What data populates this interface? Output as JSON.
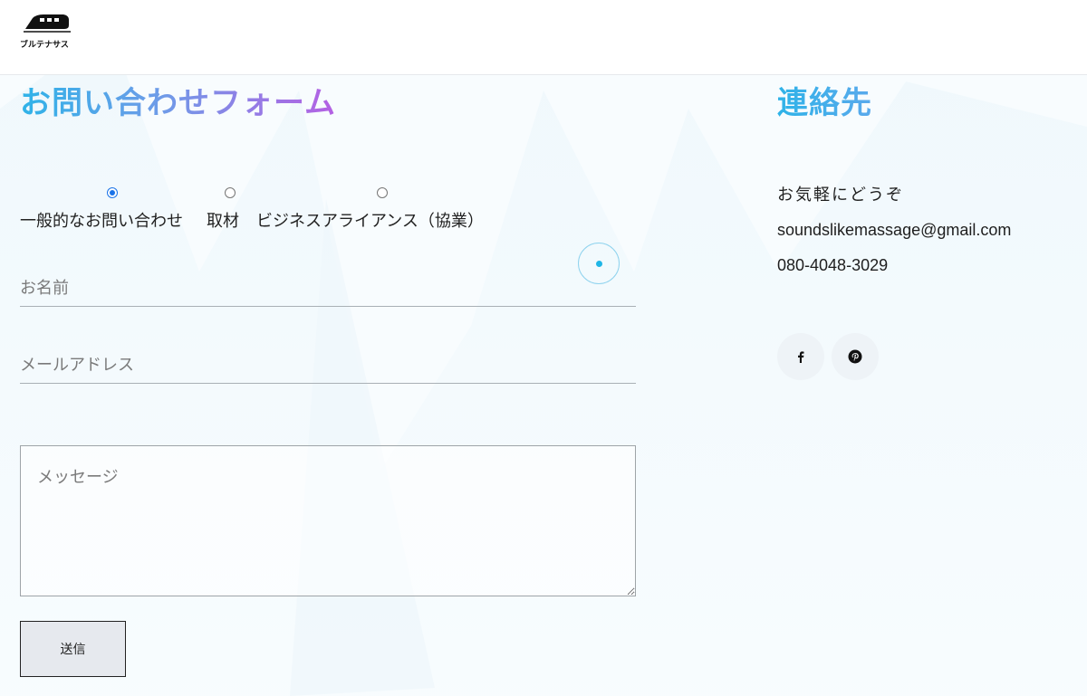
{
  "brand": {
    "logo_text": "ブルテナサス"
  },
  "form": {
    "title": "お問い合わせフォーム",
    "radios": [
      {
        "label": "一般的なお問い合わせ",
        "checked": true
      },
      {
        "label": "取材",
        "checked": false
      },
      {
        "label": "ビジネスアライアンス（協業）",
        "checked": false
      }
    ],
    "name_placeholder": "お名前",
    "email_placeholder": "メールアドレス",
    "message_placeholder": "メッセージ",
    "submit_label": "送信"
  },
  "contact": {
    "title": "連絡先",
    "tagline": "お気軽にどうぞ",
    "email": "soundslikemassage@gmail.com",
    "phone": "080-4048-3029",
    "social": [
      {
        "icon": "facebook-icon"
      },
      {
        "icon": "pinterest-icon"
      }
    ]
  },
  "colors": {
    "title_gradient_start": "#2fb3e8",
    "title_gradient_end": "#b560e3",
    "radio_selected": "#1a73e8",
    "spinner": "#1fb6e6"
  }
}
